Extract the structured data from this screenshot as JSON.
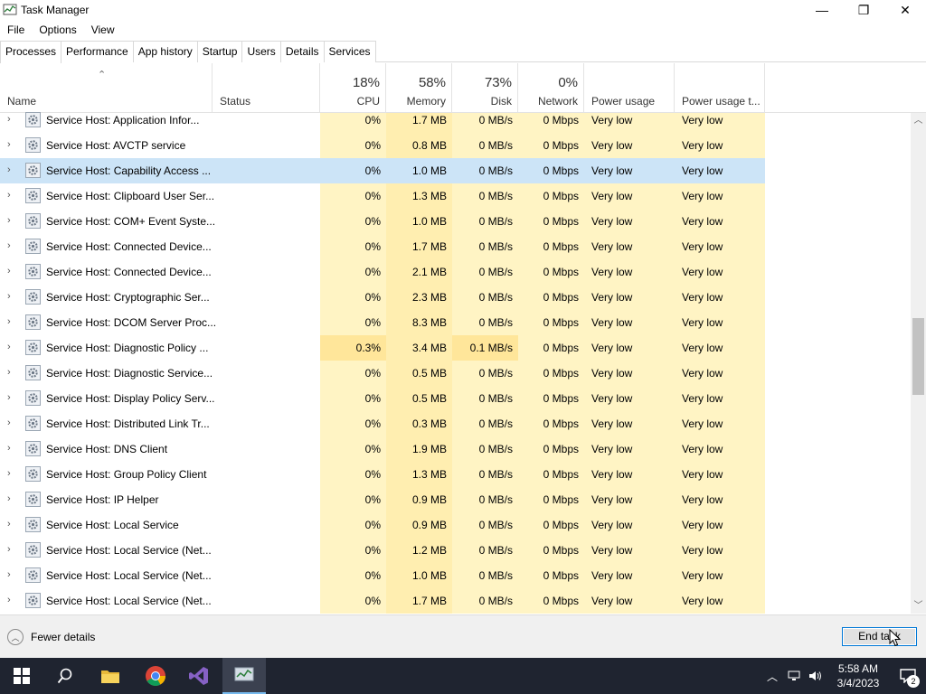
{
  "window": {
    "title": "Task Manager",
    "controls": {
      "minimize": "—",
      "restore": "❐",
      "close": "✕"
    }
  },
  "menu": [
    {
      "label": "File"
    },
    {
      "label": "Options"
    },
    {
      "label": "View"
    }
  ],
  "tabs": [
    {
      "label": "Processes",
      "active": true
    },
    {
      "label": "Performance"
    },
    {
      "label": "App history"
    },
    {
      "label": "Startup"
    },
    {
      "label": "Users"
    },
    {
      "label": "Details"
    },
    {
      "label": "Services"
    }
  ],
  "columns": {
    "name": "Name",
    "status": "Status",
    "cpu": {
      "pct": "18%",
      "label": "CPU"
    },
    "memory": {
      "pct": "58%",
      "label": "Memory"
    },
    "disk": {
      "pct": "73%",
      "label": "Disk"
    },
    "network": {
      "pct": "0%",
      "label": "Network"
    },
    "power": "Power usage",
    "power_trend": "Power usage t..."
  },
  "rows": [
    {
      "name": "Service Host: Application Infor...",
      "cpu": "0%",
      "mem": "1.7 MB",
      "disk": "0 MB/s",
      "net": "0 Mbps",
      "pow": "Very low",
      "powt": "Very low"
    },
    {
      "name": "Service Host: AVCTP service",
      "cpu": "0%",
      "mem": "0.8 MB",
      "disk": "0 MB/s",
      "net": "0 Mbps",
      "pow": "Very low",
      "powt": "Very low"
    },
    {
      "name": "Service Host: Capability Access ...",
      "cpu": "0%",
      "mem": "1.0 MB",
      "disk": "0 MB/s",
      "net": "0 Mbps",
      "pow": "Very low",
      "powt": "Very low",
      "selected": true
    },
    {
      "name": "Service Host: Clipboard User Ser...",
      "cpu": "0%",
      "mem": "1.3 MB",
      "disk": "0 MB/s",
      "net": "0 Mbps",
      "pow": "Very low",
      "powt": "Very low"
    },
    {
      "name": "Service Host: COM+ Event Syste...",
      "cpu": "0%",
      "mem": "1.0 MB",
      "disk": "0 MB/s",
      "net": "0 Mbps",
      "pow": "Very low",
      "powt": "Very low"
    },
    {
      "name": "Service Host: Connected Device...",
      "cpu": "0%",
      "mem": "1.7 MB",
      "disk": "0 MB/s",
      "net": "0 Mbps",
      "pow": "Very low",
      "powt": "Very low"
    },
    {
      "name": "Service Host: Connected Device...",
      "cpu": "0%",
      "mem": "2.1 MB",
      "disk": "0 MB/s",
      "net": "0 Mbps",
      "pow": "Very low",
      "powt": "Very low"
    },
    {
      "name": "Service Host: Cryptographic Ser...",
      "cpu": "0%",
      "mem": "2.3 MB",
      "disk": "0 MB/s",
      "net": "0 Mbps",
      "pow": "Very low",
      "powt": "Very low"
    },
    {
      "name": "Service Host: DCOM Server Proc...",
      "cpu": "0%",
      "mem": "8.3 MB",
      "disk": "0 MB/s",
      "net": "0 Mbps",
      "pow": "Very low",
      "powt": "Very low"
    },
    {
      "name": "Service Host: Diagnostic Policy ...",
      "cpu": "0.3%",
      "mem": "3.4 MB",
      "disk": "0.1 MB/s",
      "net": "0 Mbps",
      "pow": "Very low",
      "powt": "Very low",
      "hot": true
    },
    {
      "name": "Service Host: Diagnostic Service...",
      "cpu": "0%",
      "mem": "0.5 MB",
      "disk": "0 MB/s",
      "net": "0 Mbps",
      "pow": "Very low",
      "powt": "Very low"
    },
    {
      "name": "Service Host: Display Policy Serv...",
      "cpu": "0%",
      "mem": "0.5 MB",
      "disk": "0 MB/s",
      "net": "0 Mbps",
      "pow": "Very low",
      "powt": "Very low"
    },
    {
      "name": "Service Host: Distributed Link Tr...",
      "cpu": "0%",
      "mem": "0.3 MB",
      "disk": "0 MB/s",
      "net": "0 Mbps",
      "pow": "Very low",
      "powt": "Very low"
    },
    {
      "name": "Service Host: DNS Client",
      "cpu": "0%",
      "mem": "1.9 MB",
      "disk": "0 MB/s",
      "net": "0 Mbps",
      "pow": "Very low",
      "powt": "Very low"
    },
    {
      "name": "Service Host: Group Policy Client",
      "cpu": "0%",
      "mem": "1.3 MB",
      "disk": "0 MB/s",
      "net": "0 Mbps",
      "pow": "Very low",
      "powt": "Very low"
    },
    {
      "name": "Service Host: IP Helper",
      "cpu": "0%",
      "mem": "0.9 MB",
      "disk": "0 MB/s",
      "net": "0 Mbps",
      "pow": "Very low",
      "powt": "Very low"
    },
    {
      "name": "Service Host: Local Service",
      "cpu": "0%",
      "mem": "0.9 MB",
      "disk": "0 MB/s",
      "net": "0 Mbps",
      "pow": "Very low",
      "powt": "Very low"
    },
    {
      "name": "Service Host: Local Service (Net...",
      "cpu": "0%",
      "mem": "1.2 MB",
      "disk": "0 MB/s",
      "net": "0 Mbps",
      "pow": "Very low",
      "powt": "Very low"
    },
    {
      "name": "Service Host: Local Service (Net...",
      "cpu": "0%",
      "mem": "1.0 MB",
      "disk": "0 MB/s",
      "net": "0 Mbps",
      "pow": "Very low",
      "powt": "Very low"
    },
    {
      "name": "Service Host: Local Service (Net...",
      "cpu": "0%",
      "mem": "1.7 MB",
      "disk": "0 MB/s",
      "net": "0 Mbps",
      "pow": "Very low",
      "powt": "Very low"
    }
  ],
  "footer": {
    "fewer_details": "Fewer details",
    "end_task": "End task"
  },
  "taskbar": {
    "apps": [
      "windows-start-icon",
      "search-icon",
      "file-explorer-icon",
      "chrome-icon",
      "visual-studio-icon",
      "task-manager-icon"
    ],
    "time": "5:58 AM",
    "date": "3/4/2023",
    "notification_count": "2"
  },
  "colors": {
    "selected_row": "#cce4f7",
    "heat_light": "#fff4c4",
    "heat_mid": "#ffeeb0",
    "taskbar": "#1f2430",
    "accent": "#0078d7"
  }
}
